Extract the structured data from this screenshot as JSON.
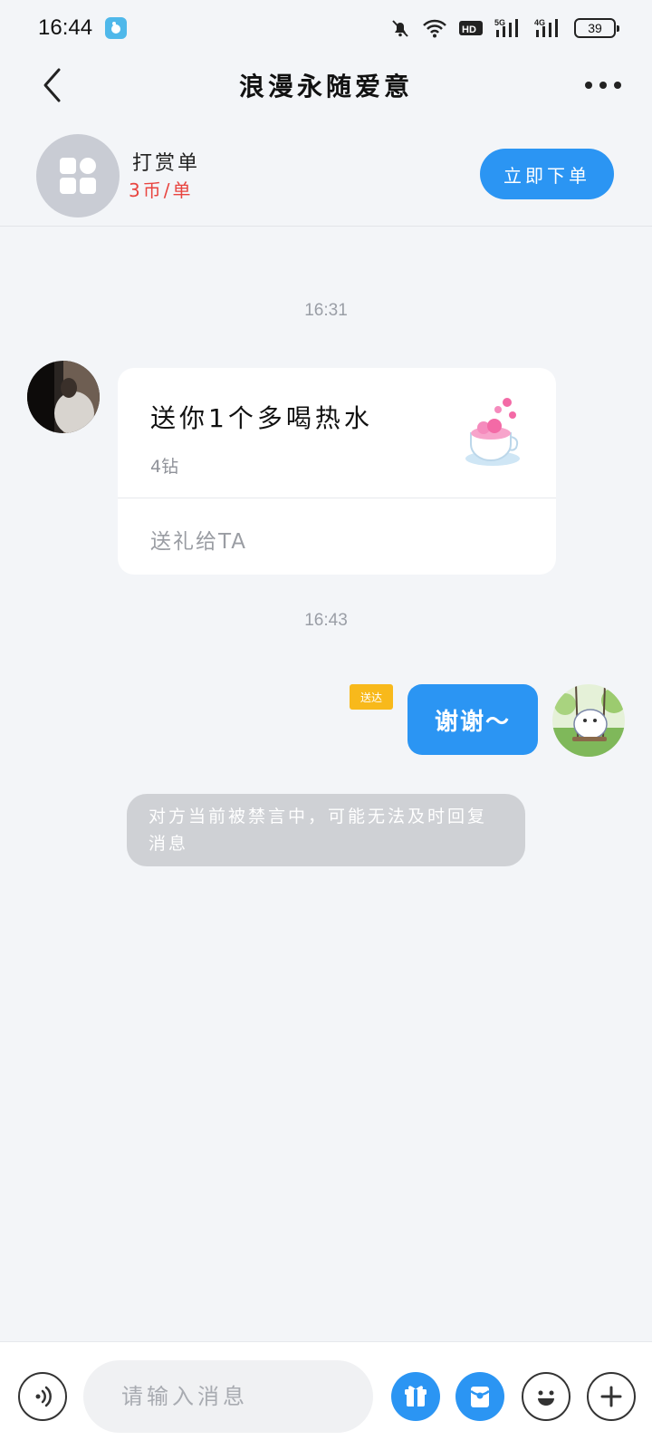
{
  "status_bar": {
    "time": "16:44",
    "battery": "39",
    "icons": [
      "app-icon",
      "mute-bell-icon",
      "wifi-icon",
      "hd-icon",
      "5g-signal-icon",
      "4g-signal-icon",
      "battery-icon"
    ]
  },
  "header": {
    "title": "浪漫永随爱意",
    "back_icon": "back-arrow-icon",
    "more_icon": "more-dots-icon"
  },
  "order_bar": {
    "title": "打赏单",
    "price": "3币/单",
    "button_label": "立即下单",
    "icon": "grid-apps-icon"
  },
  "messages": {
    "timestamp_1": "16:31",
    "gift_card": {
      "title": "送你1个多喝热水",
      "price": "4钻",
      "action": "送礼给TA",
      "image": "hot-water-cup-icon"
    },
    "timestamp_2": "16:43",
    "my_message": {
      "text": "谢谢～",
      "read_status": "送达"
    },
    "system_notice": "对方当前被禁言中，可能无法及时回复消息"
  },
  "input_bar": {
    "placeholder": "请输入消息",
    "icons": [
      "voice-icon",
      "gift-icon",
      "red-packet-icon",
      "emoji-icon",
      "plus-icon"
    ]
  },
  "colors": {
    "accent": "#2b95f3",
    "price_red": "#e8443f",
    "background": "#f3f5f8",
    "badge_yellow": "#f8b91b"
  }
}
